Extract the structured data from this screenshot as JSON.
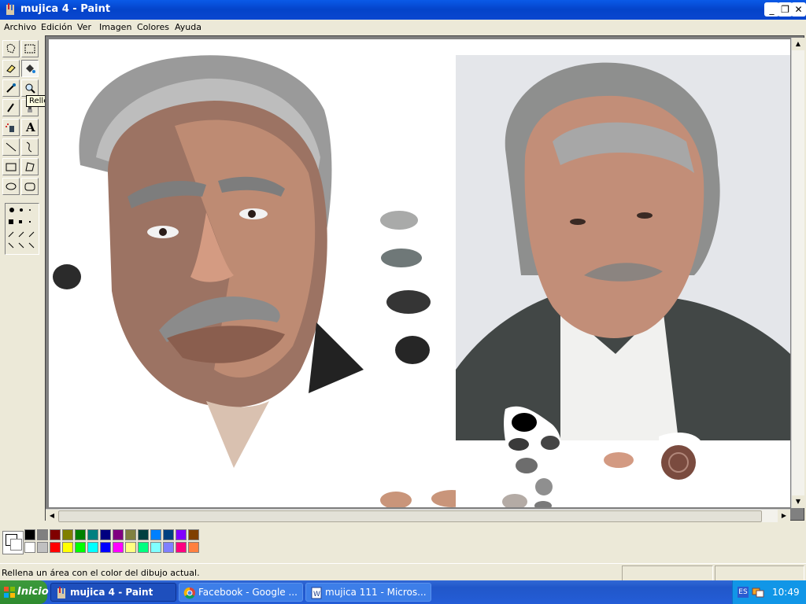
{
  "window": {
    "title": "mujica 4 - Paint",
    "min": "_",
    "max": "❐",
    "close": "✕"
  },
  "menu": [
    "Archivo",
    "Edición",
    "Ver",
    "Imagen",
    "Colores",
    "Ayuda"
  ],
  "tooltip": "Relleno con color",
  "tools": [
    {
      "name": "free-select-icon"
    },
    {
      "name": "rect-select-icon"
    },
    {
      "name": "eraser-icon"
    },
    {
      "name": "fill-icon"
    },
    {
      "name": "color-picker-icon"
    },
    {
      "name": "magnifier-icon"
    },
    {
      "name": "pencil-icon"
    },
    {
      "name": "brush-icon"
    },
    {
      "name": "airbrush-icon"
    },
    {
      "name": "text-icon",
      "glyph": "A"
    },
    {
      "name": "line-icon"
    },
    {
      "name": "curve-icon"
    },
    {
      "name": "rectangle-icon"
    },
    {
      "name": "polygon-icon"
    },
    {
      "name": "ellipse-icon"
    },
    {
      "name": "rounded-rect-icon"
    }
  ],
  "palette": {
    "top": [
      "#000000",
      "#808080",
      "#800000",
      "#808000",
      "#008000",
      "#008080",
      "#000080",
      "#800080",
      "#808040",
      "#004040",
      "#0080ff",
      "#004080",
      "#8000ff",
      "#804000"
    ],
    "bottom": [
      "#ffffff",
      "#c0c0c0",
      "#ff0000",
      "#ffff00",
      "#00ff00",
      "#00ffff",
      "#0000ff",
      "#ff00ff",
      "#ffff80",
      "#00ff80",
      "#80ffff",
      "#8080ff",
      "#ff0080",
      "#ff8040"
    ]
  },
  "status": "Rellena un área con el color del dibujo actual.",
  "taskbar": {
    "start": "Inicio",
    "tasks": [
      {
        "label": "mujica 4 - Paint",
        "active": true
      },
      {
        "label": "Facebook - Google ...",
        "active": false
      },
      {
        "label": "mujica 111 - Micros...",
        "active": false
      }
    ],
    "lang": "ES",
    "clock": "10:49"
  }
}
